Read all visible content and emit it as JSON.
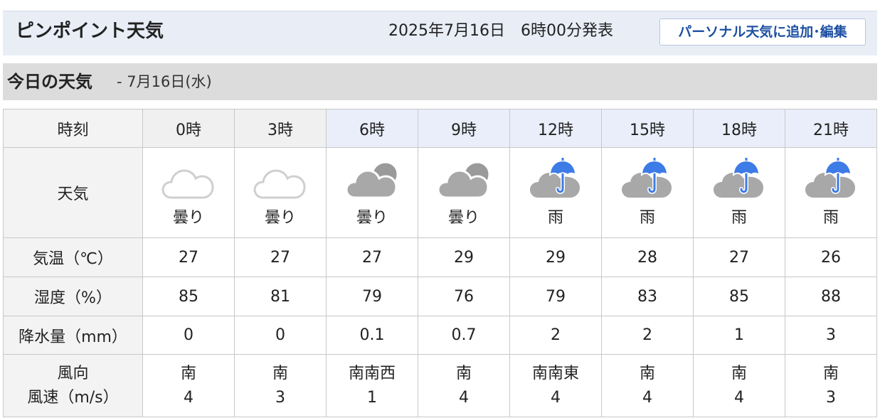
{
  "header": {
    "title": "ピンポイント天気",
    "issued": "2025年7月16日　6時00分発表",
    "personal_button": "パーソナル天気に追加･編集"
  },
  "section": {
    "title": "今日の天気",
    "date": "- 7月16日(水)"
  },
  "table": {
    "row_labels": {
      "time": "時刻",
      "weather": "天気",
      "temp": "気温（℃）",
      "humidity": "湿度（%）",
      "precip": "降水量（mm）",
      "wind_dir": "風向",
      "wind_speed": "風速（m/s）"
    },
    "hours": [
      "0時",
      "3時",
      "6時",
      "9時",
      "12時",
      "15時",
      "18時",
      "21時"
    ],
    "past": [
      true,
      true,
      false,
      false,
      false,
      false,
      false,
      false
    ],
    "weather_icons": [
      "cloud-outline-icon",
      "cloud-outline-icon",
      "cloudy-icon",
      "cloudy-icon",
      "rain-umbrella-icon",
      "rain-umbrella-icon",
      "rain-umbrella-icon",
      "rain-umbrella-icon"
    ],
    "weather": [
      "曇り",
      "曇り",
      "曇り",
      "曇り",
      "雨",
      "雨",
      "雨",
      "雨"
    ],
    "temp": [
      "27",
      "27",
      "27",
      "29",
      "29",
      "28",
      "27",
      "26"
    ],
    "humidity": [
      "85",
      "81",
      "79",
      "76",
      "79",
      "83",
      "85",
      "88"
    ],
    "precip": [
      "0",
      "0",
      "0.1",
      "0.7",
      "2",
      "2",
      "1",
      "3"
    ],
    "wind_dir": [
      "南",
      "南",
      "南南西",
      "南",
      "南南東",
      "南",
      "南",
      "南"
    ],
    "wind_speed": [
      "4",
      "3",
      "1",
      "4",
      "4",
      "4",
      "4",
      "3"
    ]
  },
  "colors": {
    "header_bg": "#e8edf6",
    "button_text": "#1e50a2",
    "umbrella": "#3d7be6",
    "cloud_dark": "#a8a8a8",
    "past_text": "#9a9a9a"
  }
}
